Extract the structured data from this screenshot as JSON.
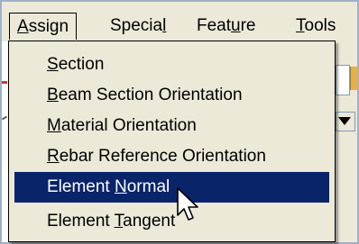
{
  "menubar": {
    "items": [
      {
        "pre": "",
        "mn": "A",
        "post": "ssign"
      },
      {
        "pre": "Specia",
        "mn": "l",
        "post": ""
      },
      {
        "pre": "Feat",
        "mn": "u",
        "post": "re"
      },
      {
        "pre": "",
        "mn": "T",
        "post": "ools"
      }
    ]
  },
  "menu": {
    "items": [
      {
        "pre": "",
        "mn": "S",
        "post": "ection"
      },
      {
        "pre": "",
        "mn": "B",
        "post": "eam Section Orientation"
      },
      {
        "pre": "",
        "mn": "M",
        "post": "aterial Orientation"
      },
      {
        "pre": "",
        "mn": "R",
        "post": "ebar Reference Orientation"
      },
      {
        "pre": "Element ",
        "mn": "N",
        "post": "ormal"
      },
      {
        "pre": "Element ",
        "mn": "T",
        "post": "angent"
      }
    ],
    "selected_index": 4
  },
  "colors": {
    "menu_bg": "#ece9d8",
    "highlight_bg": "#0a246a",
    "highlight_text": "#ffffff",
    "frame": "#9fb1c6"
  },
  "icons": {
    "cursor": "mouse-pointer-icon"
  }
}
